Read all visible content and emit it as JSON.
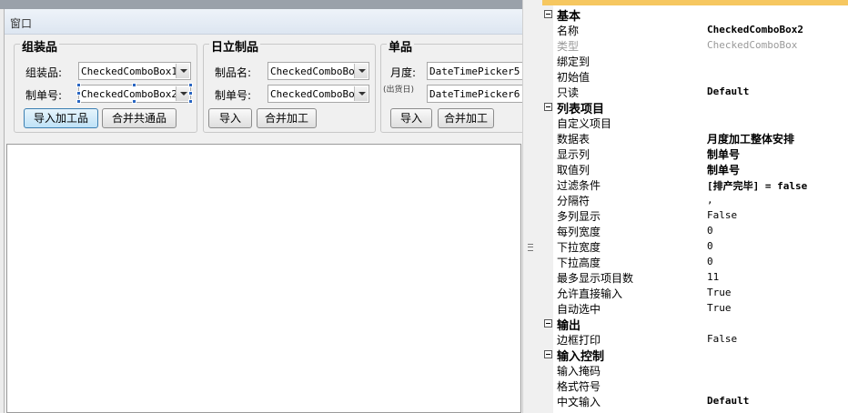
{
  "form": {
    "title": "窗口",
    "groups": {
      "assembly": {
        "title": "组装品",
        "label1": "组装品:",
        "combo1": "CheckedComboBox1",
        "label2": "制单号:",
        "combo2": "CheckedComboBox2",
        "button1": "导入加工品",
        "button2": "合并共通品"
      },
      "product": {
        "title": "日立制品",
        "label1": "制品名:",
        "combo1": "CheckedComboBox",
        "label2": "制单号:",
        "combo2": "CheckedComboBox",
        "button1": "导入",
        "button2": "合并加工"
      },
      "single": {
        "title": "单品",
        "label1": "月度:",
        "picker1": "DateTimePicker5",
        "sublabel": "(出货日)",
        "picker2": "DateTimePicker6",
        "button1": "导入",
        "button2": "合并加工"
      }
    }
  },
  "properties": {
    "cat_basic": "基本",
    "name_label": "名称",
    "name_value": "CheckedComboBox2",
    "type_label": "类型",
    "type_value": "CheckedComboBox",
    "bind_label": "绑定到",
    "init_label": "初始值",
    "readonly_label": "只读",
    "readonly_value": "Default",
    "cat_list": "列表项目",
    "custom_label": "自定义项目",
    "table_label": "数据表",
    "table_value": "月度加工整体安排",
    "display_label": "显示列",
    "display_value": "制单号",
    "valuecol_label": "取值列",
    "valuecol_value": "制单号",
    "filter_label": "过滤条件",
    "filter_value": "[排产完毕] = false",
    "sep_label": "分隔符",
    "sep_value": ",",
    "multicol_label": "多列显示",
    "multicol_value": "False",
    "colwidth_label": "每列宽度",
    "colwidth_value": "0",
    "dropwidth_label": "下拉宽度",
    "dropwidth_value": "0",
    "dropheight_label": "下拉高度",
    "dropheight_value": "0",
    "maxitems_label": "最多显示项目数",
    "maxitems_value": "11",
    "allowinput_label": "允许直接输入",
    "allowinput_value": "True",
    "autoselect_label": "自动选中",
    "autoselect_value": "True",
    "cat_output": "输出",
    "border_label": "边框打印",
    "border_value": "False",
    "cat_input": "输入控制",
    "mask_label": "输入掩码",
    "format_label": "格式符号",
    "ime_label": "中文输入",
    "ime_value": "Default"
  }
}
